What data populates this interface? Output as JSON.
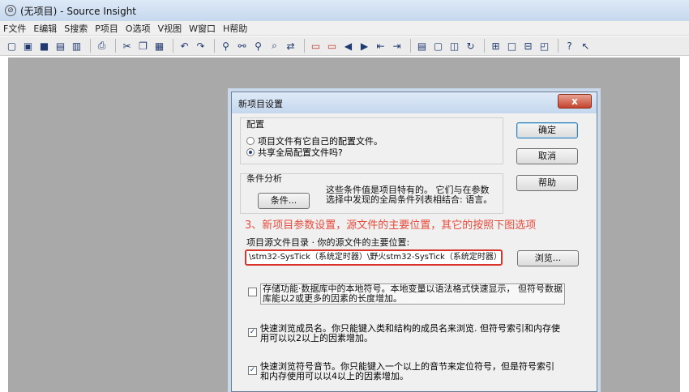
{
  "window": {
    "title": "(无项目) - Source Insight"
  },
  "menubar": {
    "items": [
      "F文件",
      "E编辑",
      "S搜索",
      "P项目",
      "O选项",
      "V视图",
      "W窗口",
      "H帮助"
    ]
  },
  "toolbar": {
    "icons": [
      "new-file-icon",
      "open-folder-icon",
      "save-icon",
      "save-all-icon",
      "close-file-icon",
      "print-icon",
      "cut-icon",
      "copy-icon",
      "paste-icon",
      "undo-icon",
      "redo-icon",
      "find-icon",
      "find-files-icon",
      "find-next-icon",
      "lookup-icon",
      "replace-icon",
      "bookmark-icon",
      "bookmark-list-icon",
      "back-icon",
      "forward-icon",
      "jump-prev-icon",
      "jump-next-icon",
      "project-window-icon",
      "symbol-window-icon",
      "context-window-icon",
      "relation-window-icon",
      "layout-1-icon",
      "layout-2-icon",
      "layout-3-icon",
      "layout-4-icon",
      "help-icon",
      "whats-this-icon"
    ]
  },
  "dialog": {
    "title": "新项目设置",
    "close_label": "x",
    "config": {
      "label": "配置",
      "option_project": "项目文件有它自己的配置文件。",
      "option_shared": "共享全局配置文件吗?",
      "selected": "option_shared"
    },
    "buttons": {
      "ok": "确定",
      "cancel": "取消",
      "help": "帮助"
    },
    "conditions": {
      "label": "条件分析",
      "button": "条件...",
      "desc_line1": "这些条件值是项目特有的。 它们与在参数",
      "desc_line2": "选择中发现的全局条件列表相结合: 语言。"
    },
    "annotation": "3、新项目参数设置，源文件的主要位置，其它的按照下图选项",
    "source_dir": {
      "label": "项目源文件目录 · 你的源文件的主要位置:",
      "value": "\\stm32-SysTick（系统定时器）\\野火stm32-SysTick（系统定时器）",
      "browse": "浏览..."
    },
    "options": [
      {
        "checked": false,
        "line1": "存储功能·数据库中的本地符号。本地变量以语法格式快速显示， 但符号数据",
        "line2": "库能以2或更多的因素的长度增加。"
      },
      {
        "checked": true,
        "line1": "快速浏览成员名。你只能键入类和结构的成员名来浏览. 但符号索引和内存使",
        "line2": "用可以以2以上的因素增加。"
      },
      {
        "checked": true,
        "line1": "快速浏览符号音节。你只能键入一个以上的音节来定位符号，但是符号索引",
        "line2": "和内存使用可以以4以上的因素增加。"
      }
    ]
  }
}
